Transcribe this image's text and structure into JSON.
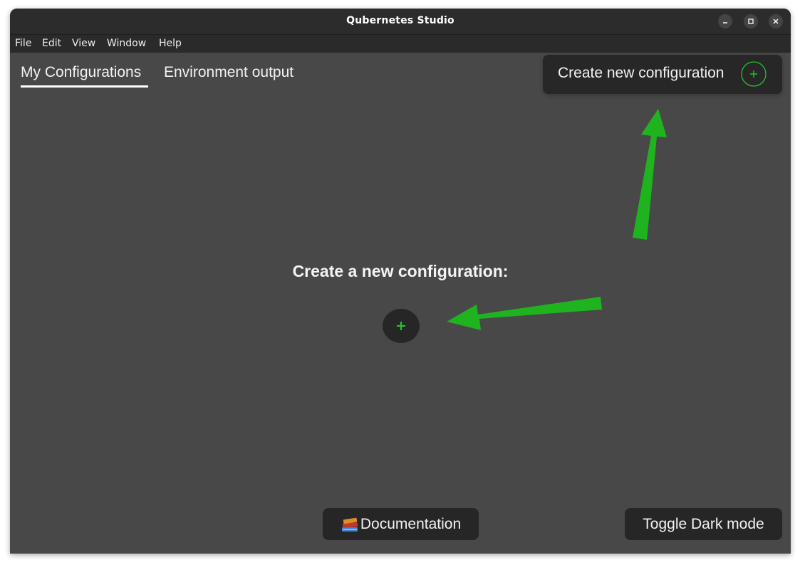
{
  "window": {
    "title": "Qubernetes Studio"
  },
  "menubar": {
    "items": [
      "File",
      "Edit",
      "View",
      "Window",
      "Help"
    ]
  },
  "tabs": [
    {
      "label": "My Configurations",
      "active": true
    },
    {
      "label": "Environment output",
      "active": false
    }
  ],
  "header": {
    "create_button_label": "Create new configuration",
    "create_button_icon": "plus-circle-icon"
  },
  "main": {
    "heading": "Create a new configuration:",
    "add_button_symbol": "+"
  },
  "footer": {
    "documentation_label": "Documentation",
    "documentation_icon": "books-icon",
    "toggle_dark_label": "Toggle Dark mode"
  },
  "colors": {
    "window_bg": "#484848",
    "titlebar_bg": "#2c2c2c",
    "button_bg": "#262626",
    "accent_green": "#23c42b",
    "annotation_arrow": "#1fb320"
  }
}
